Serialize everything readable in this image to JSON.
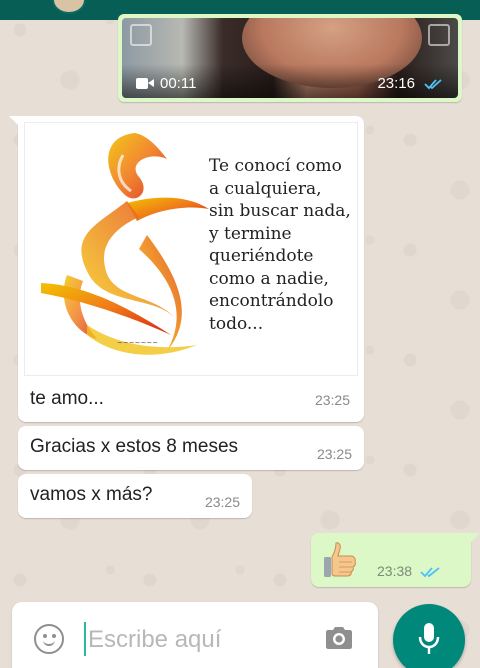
{
  "colors": {
    "header": "#075e54",
    "outgoing_bubble": "#dcf8c6",
    "incoming_bubble": "#ffffff",
    "read_tick": "#4fc3f7",
    "mic_button": "#00897b"
  },
  "video_message": {
    "duration": "00:11",
    "time": "23:16",
    "status_icon": "double-check-read-icon"
  },
  "image_message": {
    "quote": "Te conocí como\na cualquiera,\nsin buscar nada,\ny termine\nqueriéndote\ncomo a nadie,\nencontrándolo\ntodo...",
    "caption": "te amo...",
    "time": "23:25"
  },
  "text_messages": [
    {
      "text": "Gracias x estos 8 meses",
      "time": "23:25"
    },
    {
      "text": "vamos x más?",
      "time": "23:25"
    }
  ],
  "emoji_message": {
    "emoji_icon": "thumbs-up-icon",
    "time": "23:38",
    "status_icon": "double-check-read-icon"
  },
  "composer": {
    "placeholder": "Escribe aquí",
    "emoji_icon": "smiley-icon",
    "camera_icon": "camera-icon",
    "mic_icon": "microphone-icon"
  }
}
